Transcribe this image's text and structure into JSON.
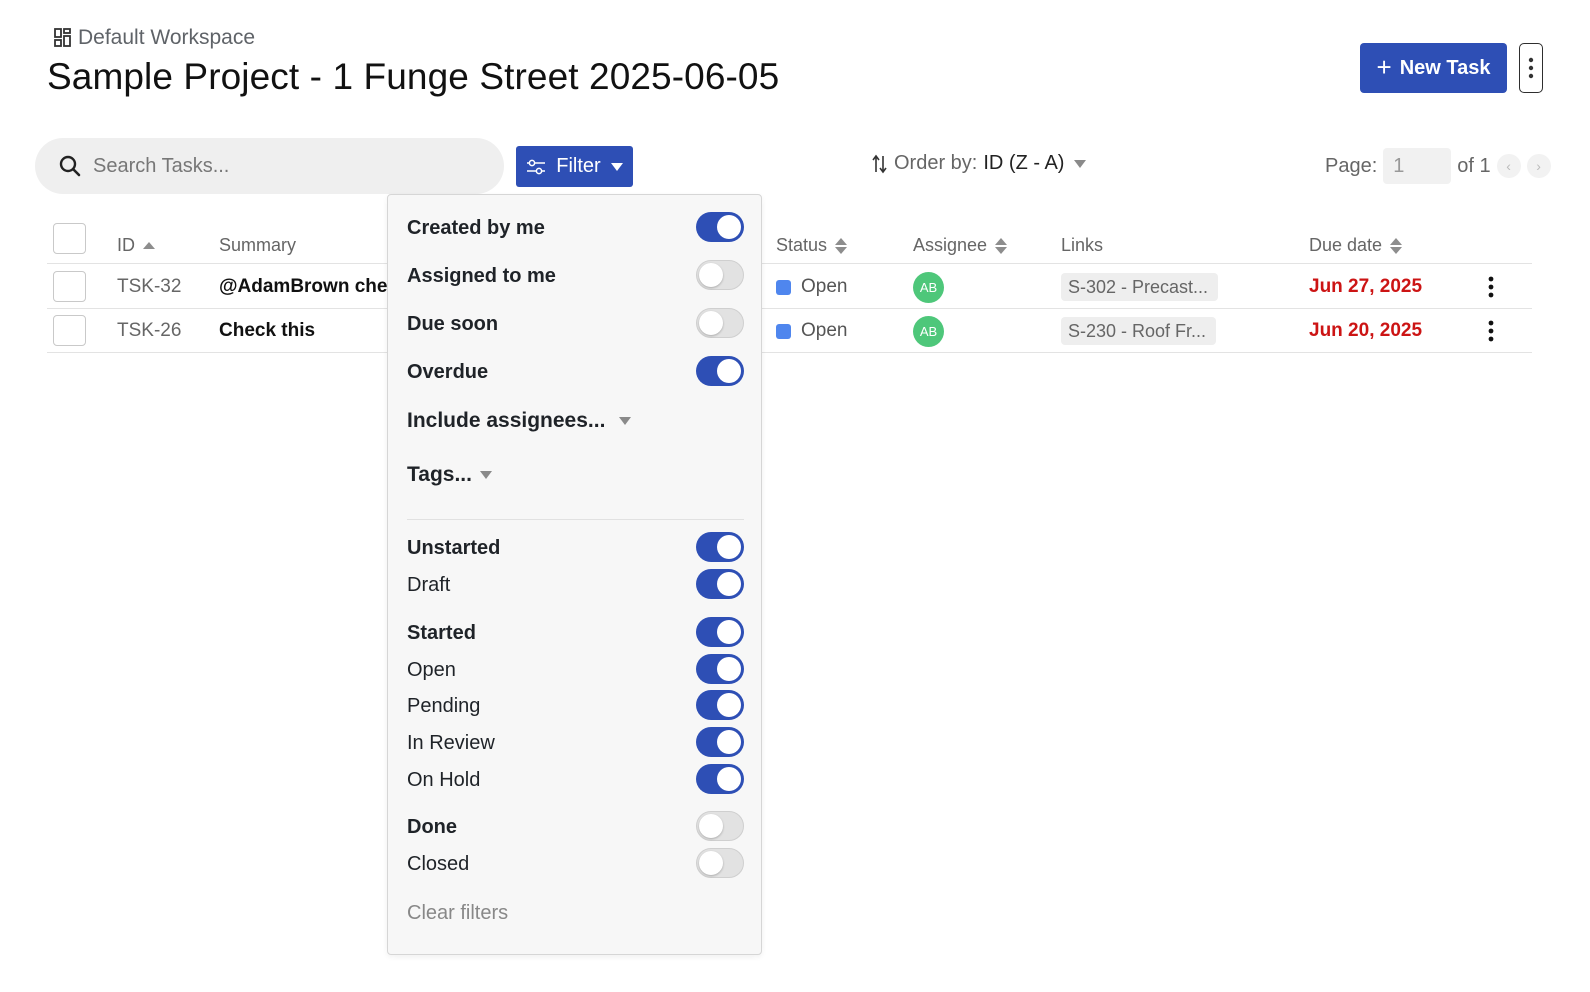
{
  "header": {
    "workspace": "Default Workspace",
    "title": "Sample Project - 1 Funge Street 2025-06-05",
    "new_task_label": "New Task"
  },
  "toolbar": {
    "search_placeholder": "Search Tasks...",
    "filter_label": "Filter",
    "order_prefix": "Order by:",
    "order_value": "ID (Z - A)",
    "page_label": "Page:",
    "page_value": "1",
    "page_of": "of 1"
  },
  "table": {
    "columns": {
      "id": "ID",
      "summary": "Summary",
      "status": "Status",
      "assignee": "Assignee",
      "links": "Links",
      "due": "Due date"
    },
    "rows": [
      {
        "id": "TSK-32",
        "summary": "@AdamBrown chec",
        "status": "Open",
        "assignee": "AB",
        "link": "S-302 - Precast...",
        "due": "Jun 27, 2025"
      },
      {
        "id": "TSK-26",
        "summary": "Check this",
        "status": "Open",
        "assignee": "AB",
        "link": "S-230 - Roof Fr...",
        "due": "Jun 20, 2025"
      }
    ]
  },
  "filter_menu": {
    "created_by_me": {
      "label": "Created by me",
      "on": true
    },
    "assigned_to_me": {
      "label": "Assigned to me",
      "on": false
    },
    "due_soon": {
      "label": "Due soon",
      "on": false
    },
    "overdue": {
      "label": "Overdue",
      "on": true
    },
    "include_assignees": "Include assignees...",
    "tags": "Tags...",
    "unstarted": {
      "label": "Unstarted",
      "on": true
    },
    "draft": {
      "label": "Draft",
      "on": true
    },
    "started": {
      "label": "Started",
      "on": true
    },
    "open": {
      "label": "Open",
      "on": true
    },
    "pending": {
      "label": "Pending",
      "on": true
    },
    "in_review": {
      "label": "In Review",
      "on": true
    },
    "on_hold": {
      "label": "On Hold",
      "on": true
    },
    "done": {
      "label": "Done",
      "on": false
    },
    "closed": {
      "label": "Closed",
      "on": false
    },
    "clear_label": "Clear filters"
  },
  "colors": {
    "accent": "#2e4fb5",
    "status_open": "#4f86ee",
    "avatar": "#4ec77a",
    "overdue": "#cc1414"
  }
}
